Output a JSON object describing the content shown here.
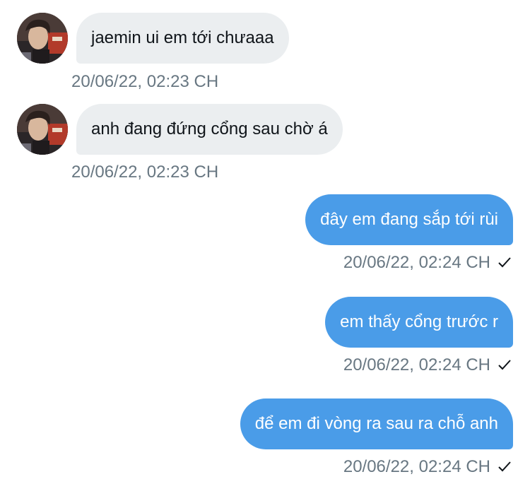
{
  "messages": [
    {
      "direction": "in",
      "text": "jaemin ui em tới chưaaa",
      "timestamp": "20/06/22, 02:23 CH",
      "avatar": "user-avatar"
    },
    {
      "direction": "in",
      "text": "anh đang đứng cổng sau chờ á",
      "timestamp": "20/06/22, 02:23 CH",
      "avatar": "user-avatar"
    },
    {
      "direction": "out",
      "text": "đây em đang sắp tới rùi",
      "timestamp": "20/06/22, 02:24 CH",
      "status_icon": "checkmark-icon"
    },
    {
      "direction": "out",
      "text": "em thấy cổng trước r",
      "timestamp": "20/06/22, 02:24 CH",
      "status_icon": "checkmark-icon"
    },
    {
      "direction": "out",
      "text": "để em đi vòng ra sau ra chỗ anh",
      "timestamp": "20/06/22, 02:24 CH",
      "status_icon": "checkmark-icon"
    }
  ],
  "colors": {
    "incoming_bubble": "#ebeef0",
    "outgoing_bubble": "#4a9ce8",
    "timestamp_text": "#687782"
  }
}
